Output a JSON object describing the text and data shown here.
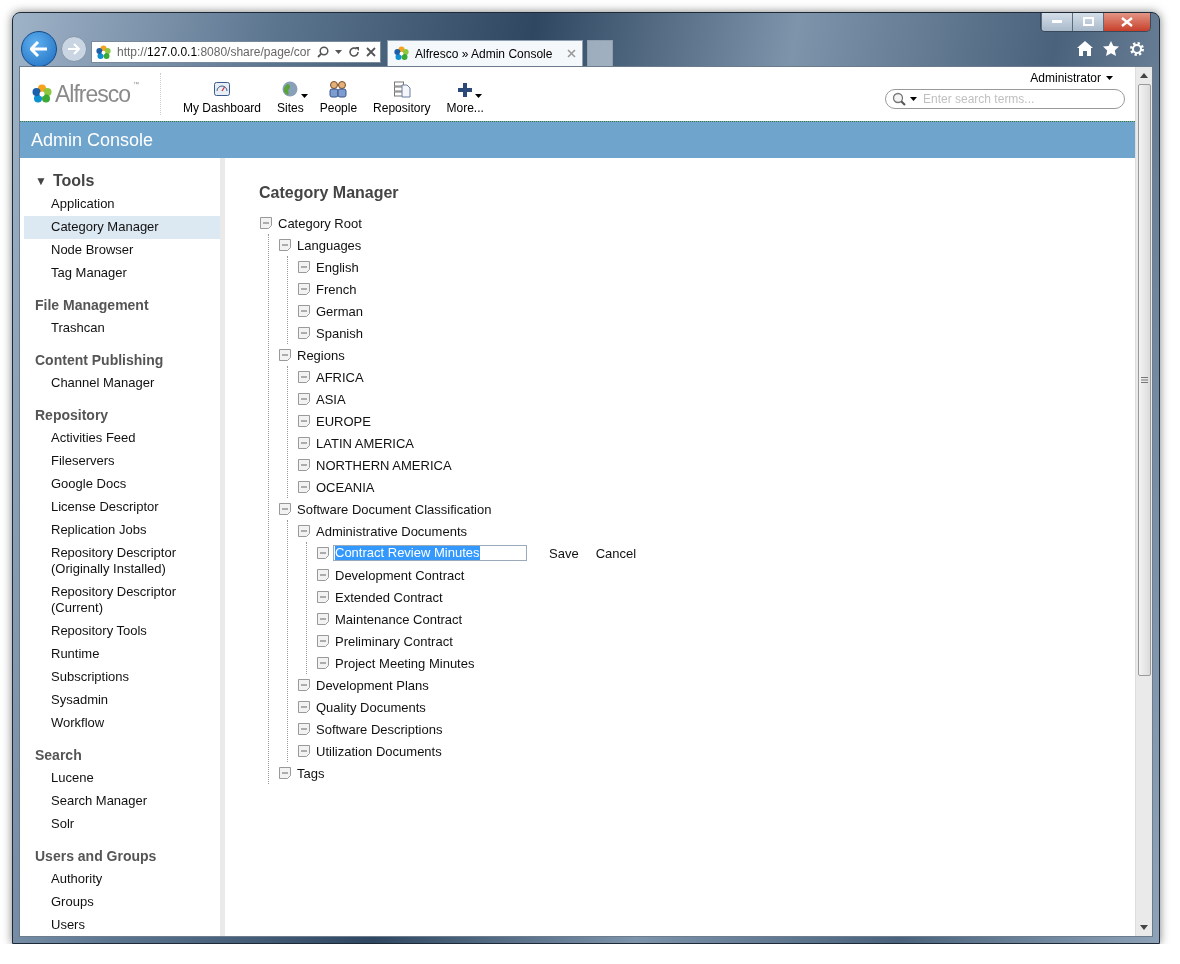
{
  "browser": {
    "address": "http://127.0.0.1:8080/share/page/cor",
    "tab": {
      "title": "Alfresco » Admin Console",
      "selected": true
    }
  },
  "header": {
    "logo": "Alfresco",
    "trademark": "™",
    "nav": [
      {
        "label": "My Dashboard",
        "kind": "dashboard",
        "menu": false
      },
      {
        "label": "Sites",
        "kind": "globe",
        "menu": true
      },
      {
        "label": "People",
        "kind": "people",
        "menu": false
      },
      {
        "label": "Repository",
        "kind": "repository",
        "menu": false
      },
      {
        "label": "More...",
        "kind": "plus",
        "menu": true
      }
    ],
    "user": "Administrator",
    "search": {
      "placeholder": "Enter search terms..."
    }
  },
  "title_bar": "Admin Console",
  "sidebar": {
    "sections": [
      {
        "title": "Tools",
        "toggle": "▼",
        "items": [
          {
            "label": "Application",
            "selected": false
          },
          {
            "label": "Category Manager",
            "selected": true
          },
          {
            "label": "Node Browser",
            "selected": false
          },
          {
            "label": "Tag Manager",
            "selected": false
          }
        ]
      },
      {
        "title": "File Management",
        "items": [
          {
            "label": "Trashcan",
            "selected": false
          }
        ]
      },
      {
        "title": "Content Publishing",
        "items": [
          {
            "label": "Channel Manager",
            "selected": false
          }
        ]
      },
      {
        "title": "Repository",
        "items": [
          {
            "label": "Activities Feed",
            "selected": false
          },
          {
            "label": "Fileservers",
            "selected": false
          },
          {
            "label": "Google Docs",
            "selected": false
          },
          {
            "label": "License Descriptor",
            "selected": false
          },
          {
            "label": "Replication Jobs",
            "selected": false
          },
          {
            "label": "Repository Descriptor (Originally Installed)",
            "selected": false
          },
          {
            "label": "Repository Descriptor (Current)",
            "selected": false
          },
          {
            "label": "Repository Tools",
            "selected": false
          },
          {
            "label": "Runtime",
            "selected": false
          },
          {
            "label": "Subscriptions",
            "selected": false
          },
          {
            "label": "Sysadmin",
            "selected": false
          },
          {
            "label": "Workflow",
            "selected": false
          }
        ]
      },
      {
        "title": "Search",
        "items": [
          {
            "label": "Lucene",
            "selected": false
          },
          {
            "label": "Search Manager",
            "selected": false
          },
          {
            "label": "Solr",
            "selected": false
          }
        ]
      },
      {
        "title": "Users and Groups",
        "items": [
          {
            "label": "Authority",
            "selected": false
          },
          {
            "label": "Groups",
            "selected": false
          },
          {
            "label": "Users",
            "selected": false
          }
        ]
      }
    ]
  },
  "page": {
    "heading": "Category Manager",
    "tree": [
      {
        "label": "Category Root",
        "children": [
          {
            "label": "Languages",
            "children": [
              {
                "label": "English"
              },
              {
                "label": "French"
              },
              {
                "label": "German"
              },
              {
                "label": "Spanish"
              }
            ]
          },
          {
            "label": "Regions",
            "children": [
              {
                "label": "AFRICA"
              },
              {
                "label": "ASIA"
              },
              {
                "label": "EUROPE"
              },
              {
                "label": "LATIN AMERICA"
              },
              {
                "label": "NORTHERN AMERICA"
              },
              {
                "label": "OCEANIA"
              }
            ]
          },
          {
            "label": "Software Document Classification",
            "children": [
              {
                "label": "Administrative Documents",
                "children": [
                  {
                    "kind": "edit",
                    "value": "Contract Review Minutes",
                    "save": "Save",
                    "cancel": "Cancel"
                  },
                  {
                    "kind": "node",
                    "label": "Development Contract"
                  },
                  {
                    "kind": "node",
                    "label": "Extended Contract"
                  },
                  {
                    "kind": "node",
                    "label": "Maintenance Contract"
                  },
                  {
                    "kind": "node",
                    "label": "Preliminary Contract"
                  },
                  {
                    "kind": "node",
                    "label": "Project Meeting Minutes"
                  }
                ]
              },
              {
                "label": "Development Plans"
              },
              {
                "label": "Quality Documents"
              },
              {
                "label": "Software Descriptions"
              },
              {
                "label": "Utilization Documents"
              }
            ]
          },
          {
            "label": "Tags"
          }
        ]
      }
    ]
  }
}
